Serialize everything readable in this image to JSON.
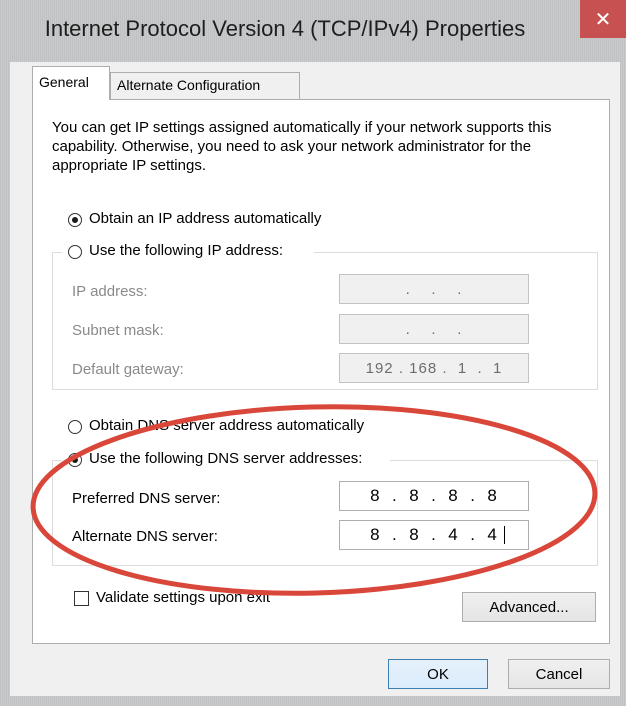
{
  "window": {
    "title": "Internet Protocol Version 4 (TCP/IPv4) Properties",
    "close_symbol": "✕"
  },
  "tabs": [
    {
      "label": "General",
      "selected": true
    },
    {
      "label": "Alternate Configuration",
      "selected": false
    }
  ],
  "description": "You can get IP settings assigned automatically if your network supports this capability. Otherwise, you need to ask your network administrator for the appropriate IP settings.",
  "ip": {
    "auto_label": "Obtain an IP address automatically",
    "manual_label": "Use the following IP address:",
    "auto_selected": true,
    "fields": [
      {
        "label": "IP address:",
        "value": "  .    .    .  "
      },
      {
        "label": "Subnet mask:",
        "value": "  .    .    .  "
      },
      {
        "label": "Default gateway:",
        "value": "192 . 168 .  1  .  1"
      }
    ]
  },
  "dns": {
    "auto_label": "Obtain DNS server address automatically",
    "manual_label": "Use the following DNS server addresses:",
    "manual_selected": true,
    "preferred_label": "Preferred DNS server:",
    "preferred_value": "8  .  8  .  8  .  8",
    "alternate_label": "Alternate DNS server:",
    "alternate_value": "8  .  8  .  4  .  4"
  },
  "validate_label": "Validate settings upon exit",
  "validate_checked": false,
  "buttons": {
    "advanced": "Advanced...",
    "ok": "OK",
    "cancel": "Cancel"
  },
  "colors": {
    "annotation_ellipse": "#d9473a",
    "close_button": "#c75050",
    "titlebar": "#c3c5c7",
    "dialog_bg": "#f0f0f0"
  }
}
